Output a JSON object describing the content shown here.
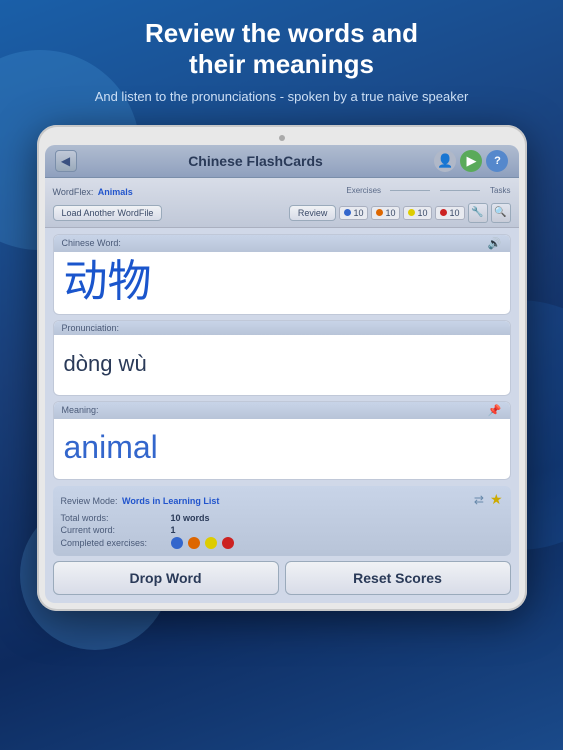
{
  "header": {
    "title_line1": "Review the words and",
    "title_line2": "their meanings",
    "subtitle": "And listen to the pronunciations - spoken by a true naive speaker"
  },
  "titlebar": {
    "title": "Chinese FlashCards",
    "back_label": "◀",
    "icon_person": "👤",
    "icon_play": "▶",
    "icon_help": "?"
  },
  "toolbar": {
    "wordfile_prefix": "WordFlex:",
    "wordfile_name": "Animals",
    "load_btn": "Load Another WordFile",
    "exercises_label": "Exercises",
    "tasks_label": "Tasks",
    "review_btn": "Review",
    "score_blue": "10",
    "score_orange": "10",
    "score_yellow": "10",
    "score_red": "10"
  },
  "card_chinese": {
    "label": "Chinese Word:",
    "content": "动物"
  },
  "card_pronunciation": {
    "label": "Pronunciation:",
    "content": "dòng wù"
  },
  "card_meaning": {
    "label": "Meaning:",
    "content": "animal"
  },
  "info": {
    "review_mode_label": "Review Mode:",
    "review_mode_value": "Words in Learning List",
    "total_words_label": "Total words:",
    "total_words_value": "10 words",
    "current_word_label": "Current word:",
    "current_word_value": "1",
    "completed_label": "Completed exercises:"
  },
  "buttons": {
    "drop_word": "Drop Word",
    "reset_scores": "Reset Scores"
  },
  "colors": {
    "dot_blue": "#3366cc",
    "dot_orange": "#dd6600",
    "dot_yellow": "#ddcc00",
    "dot_red": "#cc2222"
  }
}
